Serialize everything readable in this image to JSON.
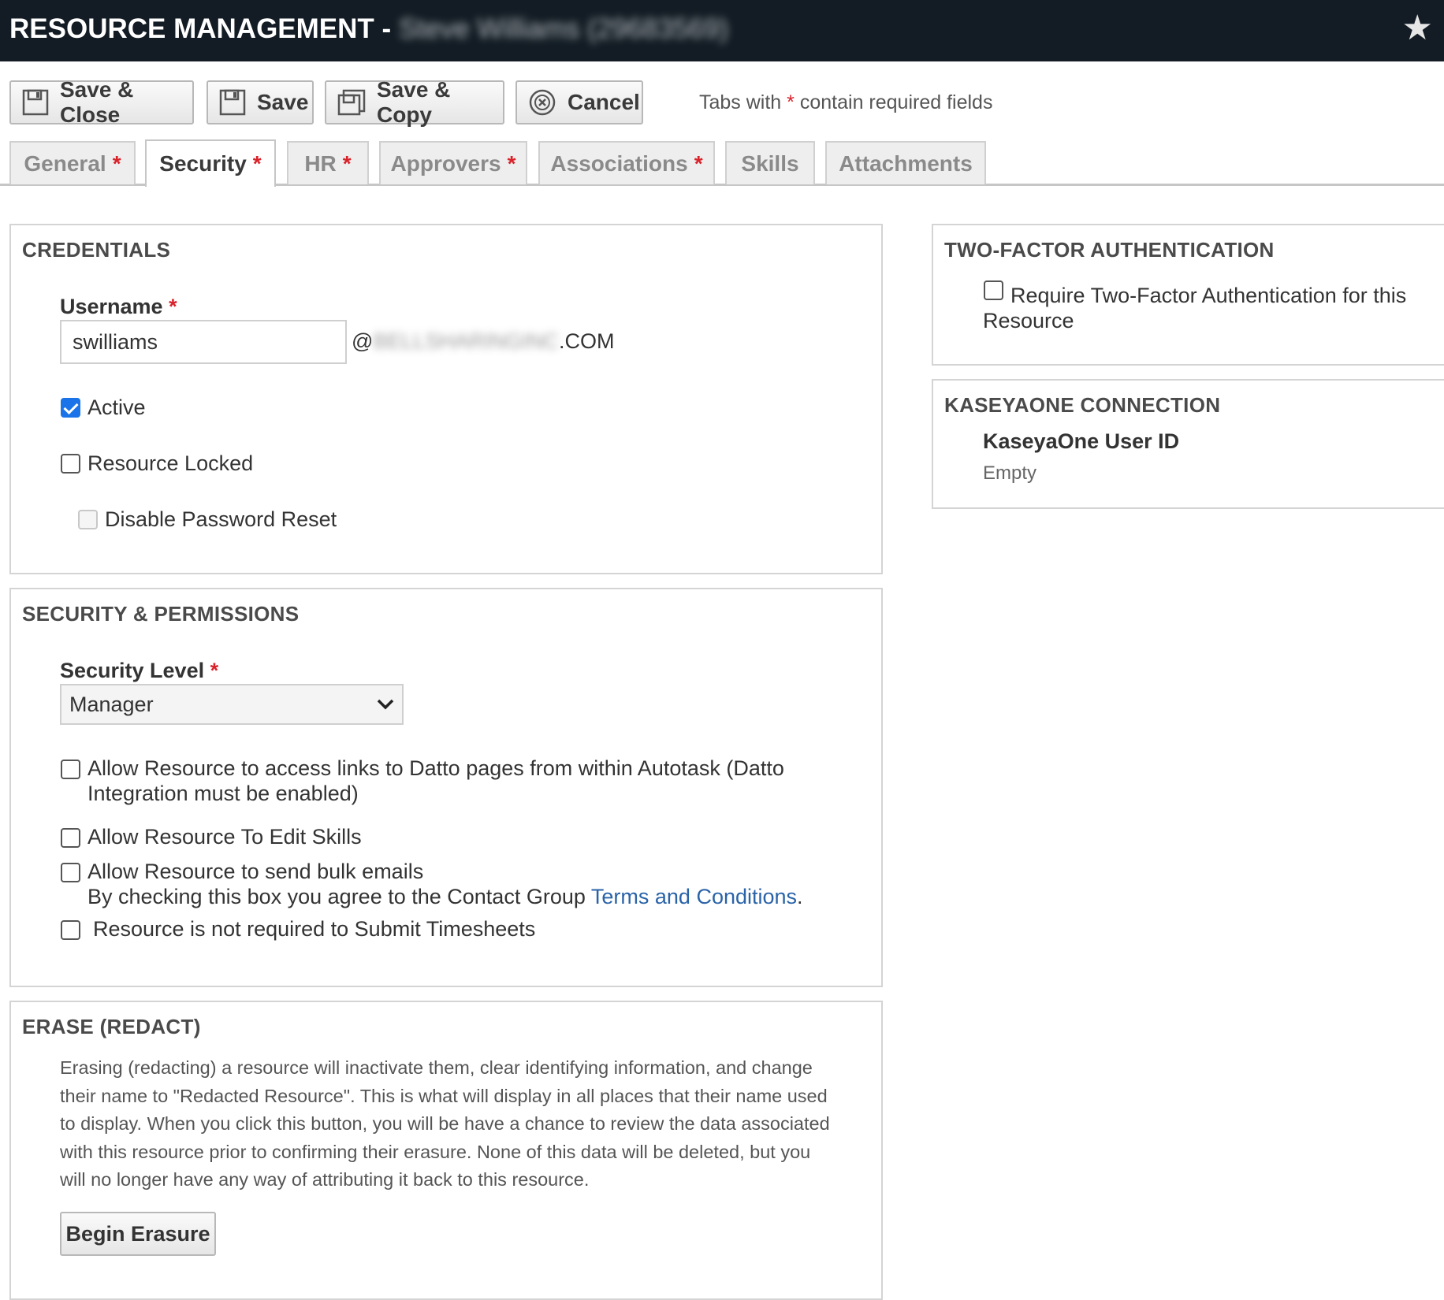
{
  "header": {
    "title": "RESOURCE MANAGEMENT -",
    "obscured_name": "Steve Williams (29683569)",
    "star_icon": "star-icon"
  },
  "toolbar": {
    "save_close_label": "Save & Close",
    "save_label": "Save",
    "save_copy_label": "Save & Copy",
    "cancel_label": "Cancel",
    "hint_prefix": "Tabs with",
    "hint_star": "*",
    "hint_suffix": "contain required fields"
  },
  "tabs": [
    {
      "label": "General",
      "required": "*"
    },
    {
      "label": "Security",
      "required": "*"
    },
    {
      "label": "HR",
      "required": "*"
    },
    {
      "label": "Approvers",
      "required": "*"
    },
    {
      "label": "Associations",
      "required": "*"
    },
    {
      "label": "Skills",
      "required": ""
    },
    {
      "label": "Attachments",
      "required": ""
    }
  ],
  "credentials": {
    "title": "CREDENTIALS",
    "username_label": "Username",
    "required_star": "*",
    "username_value": "swilliams",
    "domain_prefix": "@",
    "domain_obscured": "BELLSHARINGINC",
    "domain_suffix": ".COM",
    "active_label": "Active",
    "active_checked": true,
    "locked_label": "Resource Locked",
    "locked_checked": false,
    "disable_reset_label": "Disable Password Reset",
    "disable_reset_checked": false
  },
  "security": {
    "title": "SECURITY & PERMISSIONS",
    "level_label": "Security Level",
    "required_star": "*",
    "level_value": "Manager",
    "datto_line1": "Allow Resource to access links to Datto pages from within Autotask (Datto",
    "datto_line2": "Integration must be enabled)",
    "edit_skills_label": "Allow Resource To Edit Skills",
    "bulk_email_label": "Allow Resource to send bulk emails",
    "bulk_email_note": "By checking this box you agree to the Contact Group",
    "terms_link": "Terms and Conditions",
    "terms_period": ".",
    "timesheets_label": "Resource is not required to Submit Timesheets"
  },
  "erase": {
    "title": "ERASE (REDACT)",
    "description": "Erasing (redacting) a resource will inactivate them, clear identifying information, and change their name to \"Redacted Resource\". This is what will display in all places that their name used to display. When you click this button, you will be have a chance to review the data associated with this resource prior to confirming their erasure. None of this data will be deleted, but you will no longer have any way of attributing it back to this resource.",
    "button_label": "Begin Erasure"
  },
  "two_factor": {
    "title": "TWO-FACTOR AUTHENTICATION",
    "require_line1": "Require Two-Factor Authentication for this",
    "require_line2": "Resource",
    "require_checked": false
  },
  "kaseya": {
    "title": "KASEYAONE CONNECTION",
    "user_id_label": "KaseyaOne User ID",
    "user_id_value": "Empty"
  },
  "colors": {
    "titlebar": "#131c24",
    "required": "#d9222a",
    "link": "#2a63a8",
    "checkbox_checked": "#1a73e8"
  }
}
